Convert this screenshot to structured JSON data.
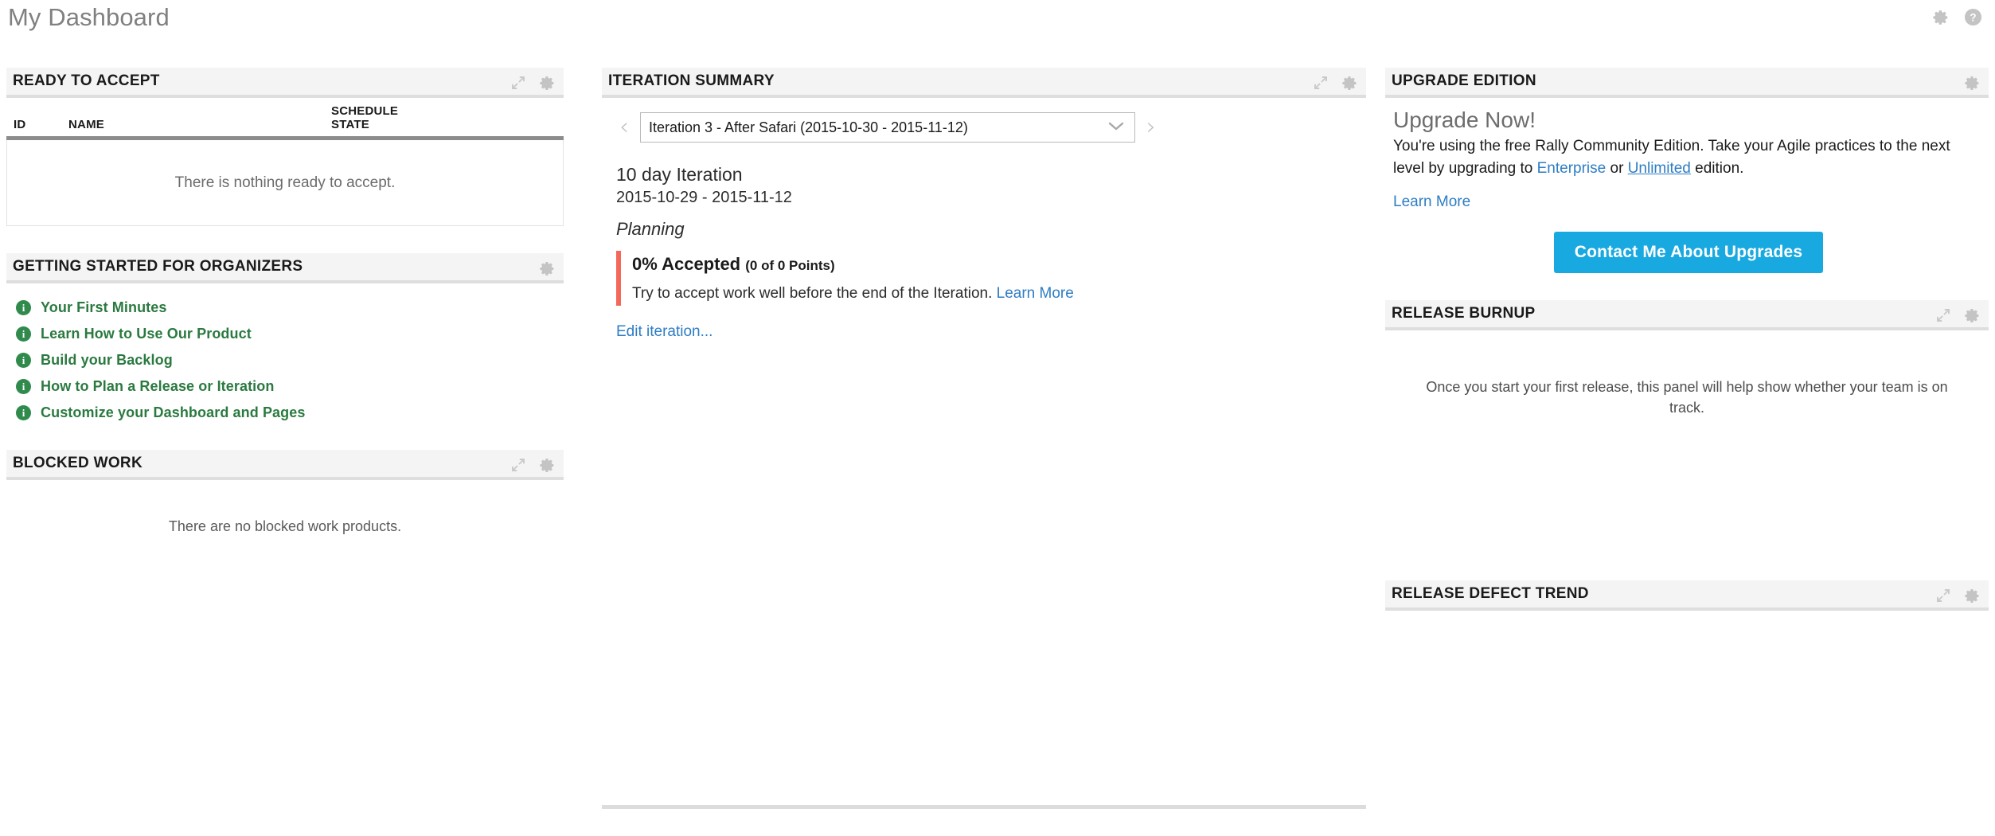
{
  "header": {
    "title": "My Dashboard",
    "icons": [
      {
        "name": "settings-icon",
        "glyph": "gear"
      },
      {
        "name": "help-icon",
        "glyph": "question-circle"
      }
    ]
  },
  "colors": {
    "accent_button": "#18a9e0",
    "link": "#2e7dc4",
    "list_link": "#2a7a40",
    "alert_bar": "#f4685c",
    "panel_header_bg": "#f4f4f4",
    "panel_header_border": "#dedede",
    "table_header_border": "#8c8c8c"
  },
  "panels": {
    "ready_to_accept": {
      "title": "READY TO ACCEPT",
      "tools": [
        "expand-icon",
        "gear-icon"
      ],
      "columns": [
        "ID",
        "NAME",
        "SCHEDULE STATE"
      ],
      "columns_split": {
        "id": "ID",
        "name": "NAME",
        "schedule": "SCHEDULE",
        "state": "STATE"
      },
      "rows": [],
      "empty_message": "There is nothing ready to accept."
    },
    "getting_started": {
      "title": "GETTING STARTED FOR ORGANIZERS",
      "tools": [
        "gear-icon"
      ],
      "items": [
        {
          "label": "Your First Minutes",
          "icon": "info-icon"
        },
        {
          "label": "Learn How to Use Our Product",
          "icon": "info-icon"
        },
        {
          "label": "Build your Backlog",
          "icon": "info-icon"
        },
        {
          "label": "How to Plan a Release or Iteration",
          "icon": "info-icon"
        },
        {
          "label": "Customize your Dashboard and Pages",
          "icon": "info-icon"
        }
      ]
    },
    "blocked_work": {
      "title": "BLOCKED WORK",
      "tools": [
        "expand-icon",
        "gear-icon"
      ],
      "empty_message": "There are no blocked work products."
    },
    "iteration_summary": {
      "title": "ITERATION SUMMARY",
      "tools": [
        "expand-icon",
        "gear-icon"
      ],
      "prev_label": "‹",
      "next_label": "›",
      "selected_iteration": "Iteration 3 - After Safari (2015-10-30 - 2015-11-12)",
      "iteration_length": "10 day Iteration",
      "iteration_dates": "2015-10-29 - 2015-11-12",
      "iteration_state": "Planning",
      "accepted_percent": "0% Accepted",
      "accepted_points": "(0 of 0 Points)",
      "advice_text": "Try to accept work well before the end of the Iteration.",
      "advice_link": "Learn More",
      "edit_link": "Edit iteration..."
    },
    "upgrade_edition": {
      "title": "UPGRADE EDITION",
      "tools": [
        "gear-icon"
      ],
      "heading": "Upgrade Now!",
      "body_part1": "You're using the free Rally Community Edition. Take your Agile practices to the next level by upgrading to ",
      "link_enterprise": "Enterprise",
      "body_part2": " or ",
      "link_unlimited": "Unlimited",
      "body_part3": " edition.",
      "learn_more": "Learn More",
      "cta_button": "Contact Me About Upgrades"
    },
    "release_burnup": {
      "title": "RELEASE BURNUP",
      "tools": [
        "expand-icon",
        "gear-icon"
      ],
      "empty_message": "Once you start your first release, this panel will help show whether your team is on track."
    },
    "release_defect_trend": {
      "title": "RELEASE DEFECT TREND",
      "tools": [
        "expand-icon",
        "gear-icon"
      ],
      "empty_message": ""
    }
  }
}
